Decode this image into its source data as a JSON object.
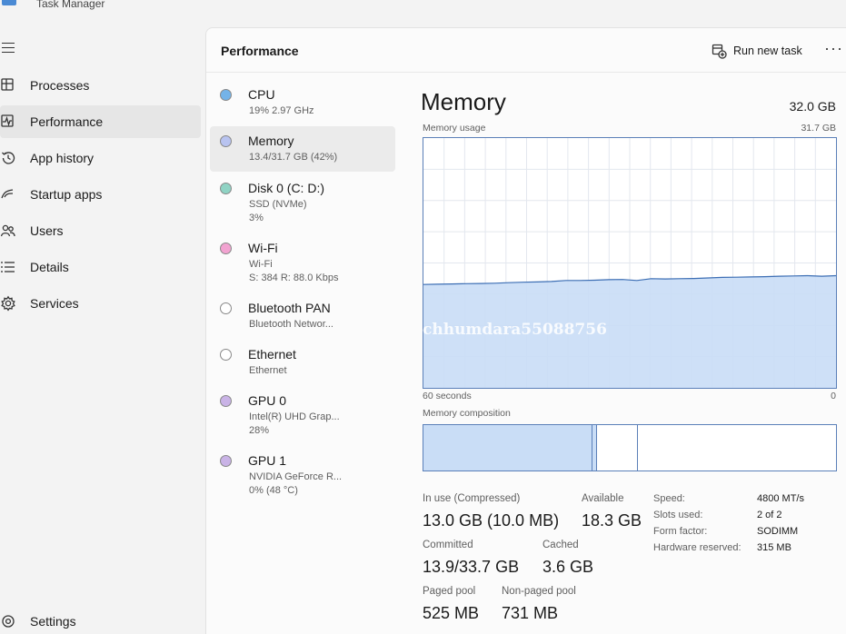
{
  "app": {
    "title": "Task Manager"
  },
  "nav": {
    "items": [
      {
        "label": "Processes",
        "icon": "processes-icon"
      },
      {
        "label": "Performance",
        "icon": "performance-icon",
        "active": true
      },
      {
        "label": "App history",
        "icon": "app-history-icon"
      },
      {
        "label": "Startup apps",
        "icon": "startup-apps-icon"
      },
      {
        "label": "Users",
        "icon": "users-icon"
      },
      {
        "label": "Details",
        "icon": "details-icon"
      },
      {
        "label": "Services",
        "icon": "services-icon"
      }
    ],
    "settings_label": "Settings"
  },
  "header": {
    "title": "Performance",
    "run_task_label": "Run new task",
    "more_label": "···"
  },
  "devices": [
    {
      "name": "CPU",
      "sub1": "19%  2.97 GHz",
      "sub2": "",
      "color": "#74b3e8"
    },
    {
      "name": "Memory",
      "sub1": "13.4/31.7 GB (42%)",
      "sub2": "",
      "color": "#b8c3f0",
      "active": true
    },
    {
      "name": "Disk 0 (C: D:)",
      "sub1": "SSD (NVMe)",
      "sub2": "3%",
      "color": "#8fd3c4"
    },
    {
      "name": "Wi-Fi",
      "sub1": "Wi-Fi",
      "sub2": "S: 384  R: 88.0 Kbps",
      "color": "#f2a3d1"
    },
    {
      "name": "Bluetooth PAN",
      "sub1": "Bluetooth Networ...",
      "sub2": "",
      "color": "#ffffff"
    },
    {
      "name": "Ethernet",
      "sub1": "Ethernet",
      "sub2": "",
      "color": "#ffffff"
    },
    {
      "name": "GPU 0",
      "sub1": "Intel(R) UHD Grap...",
      "sub2": "28%",
      "color": "#c9b3e6"
    },
    {
      "name": "GPU 1",
      "sub1": "NVIDIA GeForce R...",
      "sub2": "0% (48 °C)",
      "color": "#c9b3e6"
    }
  ],
  "memory": {
    "title": "Memory",
    "total": "32.0 GB",
    "usage_label": "Memory usage",
    "usage_max": "31.7 GB",
    "time_left": "60 seconds",
    "time_right": "0",
    "composition_label": "Memory composition",
    "usage_history": [
      0.414,
      0.415,
      0.416,
      0.417,
      0.418,
      0.419,
      0.421,
      0.423,
      0.424,
      0.426,
      0.43,
      0.43,
      0.431,
      0.433,
      0.434,
      0.43,
      0.437,
      0.436,
      0.437,
      0.438,
      0.44,
      0.442,
      0.443,
      0.444,
      0.445,
      0.447,
      0.448,
      0.449,
      0.447,
      0.449
    ],
    "composition": {
      "in_use": 0.41,
      "modified": 0.01,
      "standby": 0.1
    },
    "stats": {
      "in_use_label": "In use (Compressed)",
      "in_use_value": "13.0 GB (10.0 MB)",
      "available_label": "Available",
      "available_value": "18.3 GB",
      "committed_label": "Committed",
      "committed_value": "13.9/33.7 GB",
      "cached_label": "Cached",
      "cached_value": "3.6 GB",
      "paged_label": "Paged pool",
      "paged_value": "525 MB",
      "nonpaged_label": "Non-paged pool",
      "nonpaged_value": "731 MB"
    },
    "specs": [
      {
        "label": "Speed:",
        "value": "4800 MT/s"
      },
      {
        "label": "Slots used:",
        "value": "2 of 2"
      },
      {
        "label": "Form factor:",
        "value": "SODIMM"
      },
      {
        "label": "Hardware reserved:",
        "value": "315 MB"
      }
    ]
  },
  "watermark": "chhumdara55088756",
  "colors": {
    "graph_fill": "#c9ddf6",
    "graph_line": "#3c6eb4",
    "grid": "#e3e7ee"
  }
}
